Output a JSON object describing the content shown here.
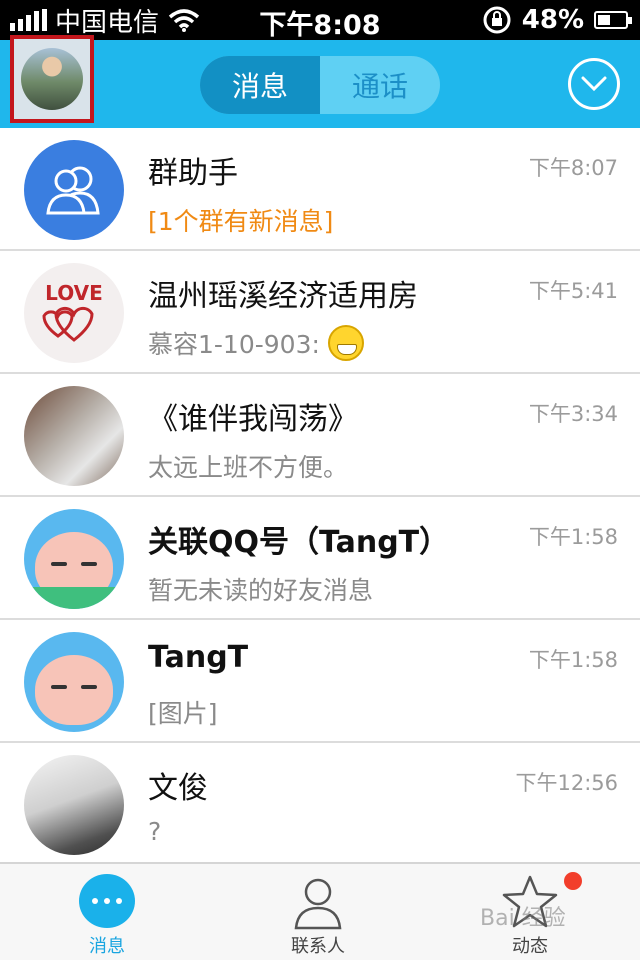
{
  "status_bar": {
    "carrier": "中国电信",
    "time": "下午8:08",
    "battery": "48%",
    "battery_level": 0.48
  },
  "header": {
    "tabs": [
      {
        "label": "消息",
        "active": true
      },
      {
        "label": "通话",
        "active": false
      }
    ],
    "dropdown_icon": "chevron-down-circle-icon"
  },
  "conversations": [
    {
      "name": "群助手",
      "message": "[1个群有新消息]",
      "time": "下午8:07",
      "avatar": "group-avatar-icon",
      "message_color": "#f08a14"
    },
    {
      "name": "温州瑶溪经济适用房",
      "message": "慕容1-10-903:",
      "time": "下午5:41",
      "avatar": "love-hearts-avatar",
      "emoji": "grin-emoji-icon"
    },
    {
      "name": "《谁伴我闯荡》",
      "message": "太远上班不方便。",
      "time": "下午3:34",
      "avatar": "guitar-player-avatar"
    },
    {
      "name": "关联QQ号（TangT）",
      "message": "暂无未读的好友消息",
      "time": "下午1:58",
      "avatar": "cartoon-girl-avatar"
    },
    {
      "name": "TangT",
      "message": "[图片]",
      "time": "下午1:58",
      "avatar": "cartoon-girl-avatar"
    },
    {
      "name": "文俊",
      "message": "?",
      "time": "下午12:56",
      "avatar": "black-white-photo-avatar"
    }
  ],
  "tabbar": {
    "items": [
      {
        "label": "消息",
        "active": true,
        "icon": "message-bubble-icon"
      },
      {
        "label": "联系人",
        "active": false,
        "icon": "contacts-icon"
      },
      {
        "label": "动态",
        "active": false,
        "icon": "star-icon",
        "badge": true
      }
    ]
  },
  "watermark": "Bai 经验",
  "colors": {
    "header": "#1fb7ec",
    "accent": "#1aa5e0",
    "badge": "#f23e2b",
    "highlight_border": "#c3161c"
  }
}
